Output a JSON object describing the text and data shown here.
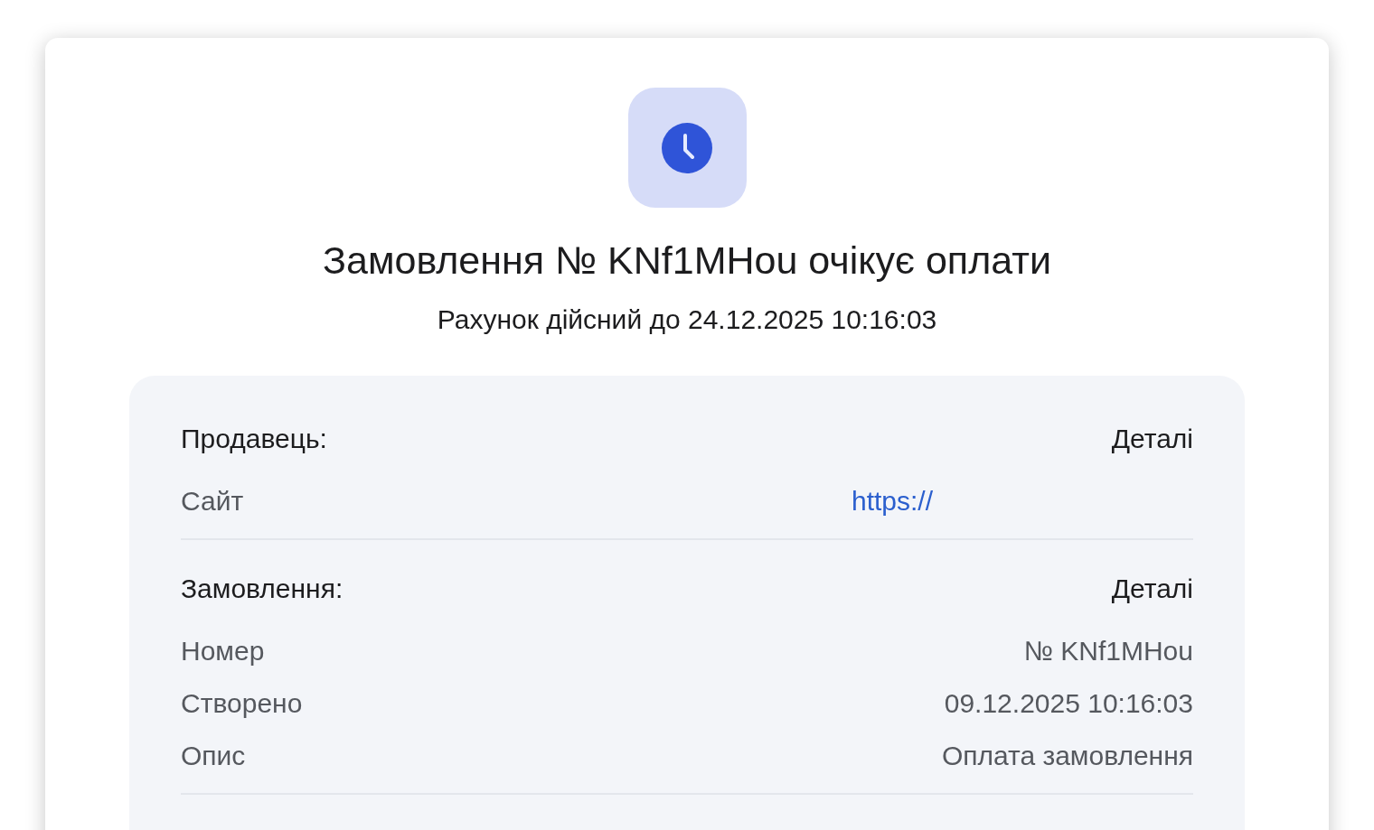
{
  "title": "Замовлення № KNf1MHou очікує оплати",
  "subtitle": "Рахунок дійсний до 24.12.2025 10:16:03",
  "sections": [
    {
      "heading": "Продавець:",
      "details": "Деталі",
      "rows": [
        {
          "kind": "link",
          "label": "Сайт",
          "value": "https://"
        }
      ]
    },
    {
      "heading": "Замовлення:",
      "details": "Деталі",
      "rows": [
        {
          "kind": "text",
          "label": "Номер",
          "value": "№ KNf1MHou"
        },
        {
          "kind": "text",
          "label": "Створено",
          "value": "09.12.2025 10:16:03"
        },
        {
          "kind": "text",
          "label": "Опис",
          "value": "Оплата замовлення"
        }
      ]
    }
  ]
}
